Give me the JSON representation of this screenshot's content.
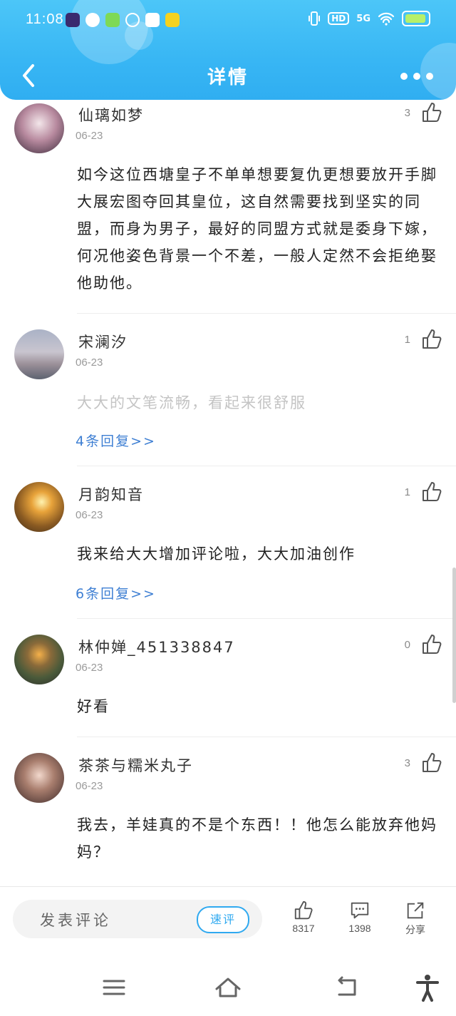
{
  "status_bar": {
    "time": "11:08",
    "hd": "HD",
    "network": "5G"
  },
  "header": {
    "title": "详情"
  },
  "comments": [
    {
      "username": "仙璃如梦",
      "date": "06-23",
      "likes": "3",
      "content": "如今这位西塘皇子不单单想要复仇更想要放开手脚大展宏图夺回其皇位，这自然需要找到坚实的同盟，而身为男子，最好的同盟方式就是委身下嫁，何况他姿色背景一个不差，一般人定然不会拒绝娶他助他。"
    },
    {
      "username": "宋澜汐",
      "date": "06-23",
      "likes": "1",
      "content": "大大的文笔流畅，看起来很舒服",
      "replies": "4条回复>>"
    },
    {
      "username": "月韵知音",
      "date": "06-23",
      "likes": "1",
      "content": "我来给大大增加评论啦，大大加油创作",
      "replies": "6条回复>>"
    },
    {
      "username": "林仲婵_451338847",
      "date": "06-23",
      "likes": "0",
      "content": "好看"
    },
    {
      "username": "茶茶与糯米丸子",
      "date": "06-23",
      "likes": "3",
      "content": "我去，羊娃真的不是个东西！！他怎么能放弃他妈妈？"
    }
  ],
  "bottom_bar": {
    "comment_placeholder": "发表评论",
    "quick_review": "速评",
    "like_count": "8317",
    "comment_count": "1398",
    "share_label": "分享"
  },
  "colors": {
    "header_blue": "#38b6f4",
    "reply_link": "#3e7fd3",
    "quick_review": "#2fa9f0"
  },
  "icons": [
    "back-arrow-icon",
    "more-dots-icon",
    "thumbs-up-icon",
    "comment-icon",
    "share-icon",
    "menu-icon",
    "home-icon",
    "return-icon",
    "accessibility-icon"
  ]
}
